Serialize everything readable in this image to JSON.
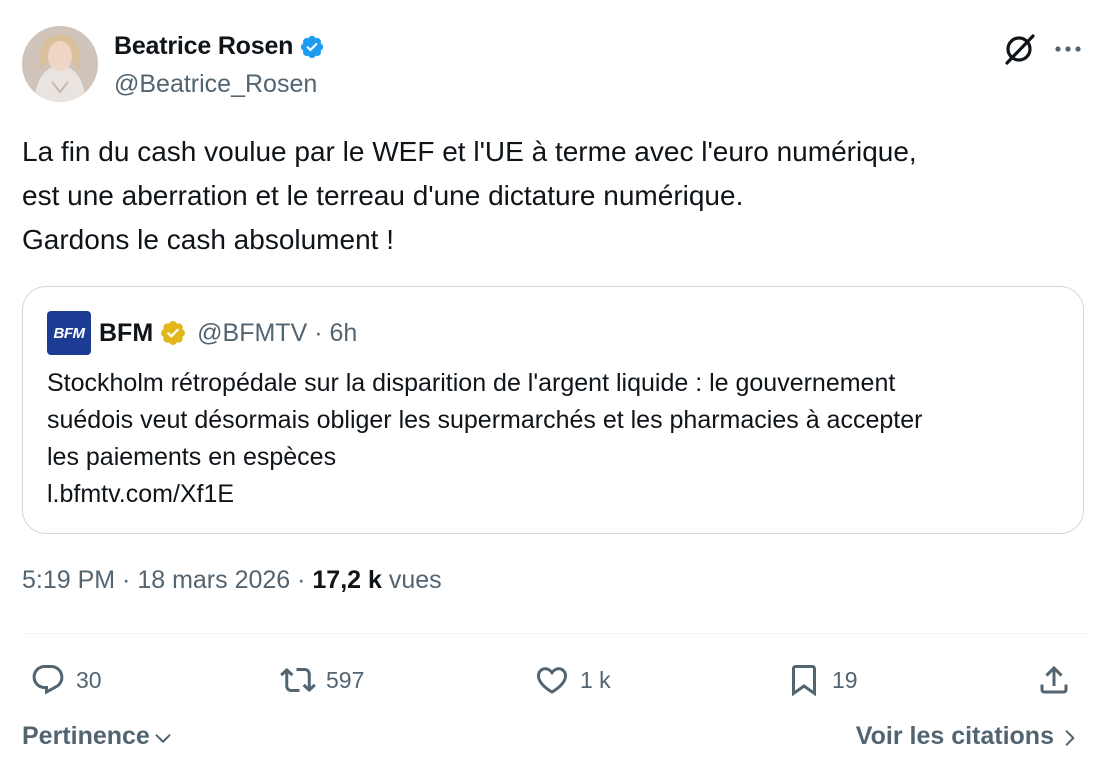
{
  "author": {
    "name": "Beatrice Rosen",
    "handle": "@Beatrice_Rosen",
    "verified_color": "#1d9bf0"
  },
  "tweet": {
    "lines": [
      "La fin du cash voulue par le WEF et l'UE à terme avec l'euro numérique,",
      "est une aberration et le terreau d'une dictature numérique.",
      "Gardons le cash absolument !"
    ]
  },
  "quote": {
    "logo_text": "BFM",
    "name": "BFM",
    "handle_time": "@BFMTV · 6h",
    "badge_color": "#e2b719",
    "lines": [
      "Stockholm rétropédale sur la disparition de l'argent liquide : le gouvernement",
      "suédois veut désormais obliger les supermarchés et les pharmacies à accepter",
      "les paiements en espèces",
      "l.bfmtv.com/Xf1E"
    ]
  },
  "meta": {
    "time_date": "5:19 PM · 18 mars 2026 · ",
    "views_count": "17,2 k",
    "views_label": " vues"
  },
  "actions": {
    "replies": "30",
    "reposts": "597",
    "likes": "1 k",
    "bookmarks": "19"
  },
  "bottom": {
    "sort_label": "Pertinence",
    "quotes_label": "Voir les citations"
  },
  "icons": {
    "verified": "verified-badge-icon",
    "grok": "grok-icon",
    "more": "more-icon",
    "reply": "reply-icon",
    "repost": "repost-icon",
    "like": "heart-icon",
    "bookmark": "bookmark-icon",
    "share": "share-icon"
  }
}
